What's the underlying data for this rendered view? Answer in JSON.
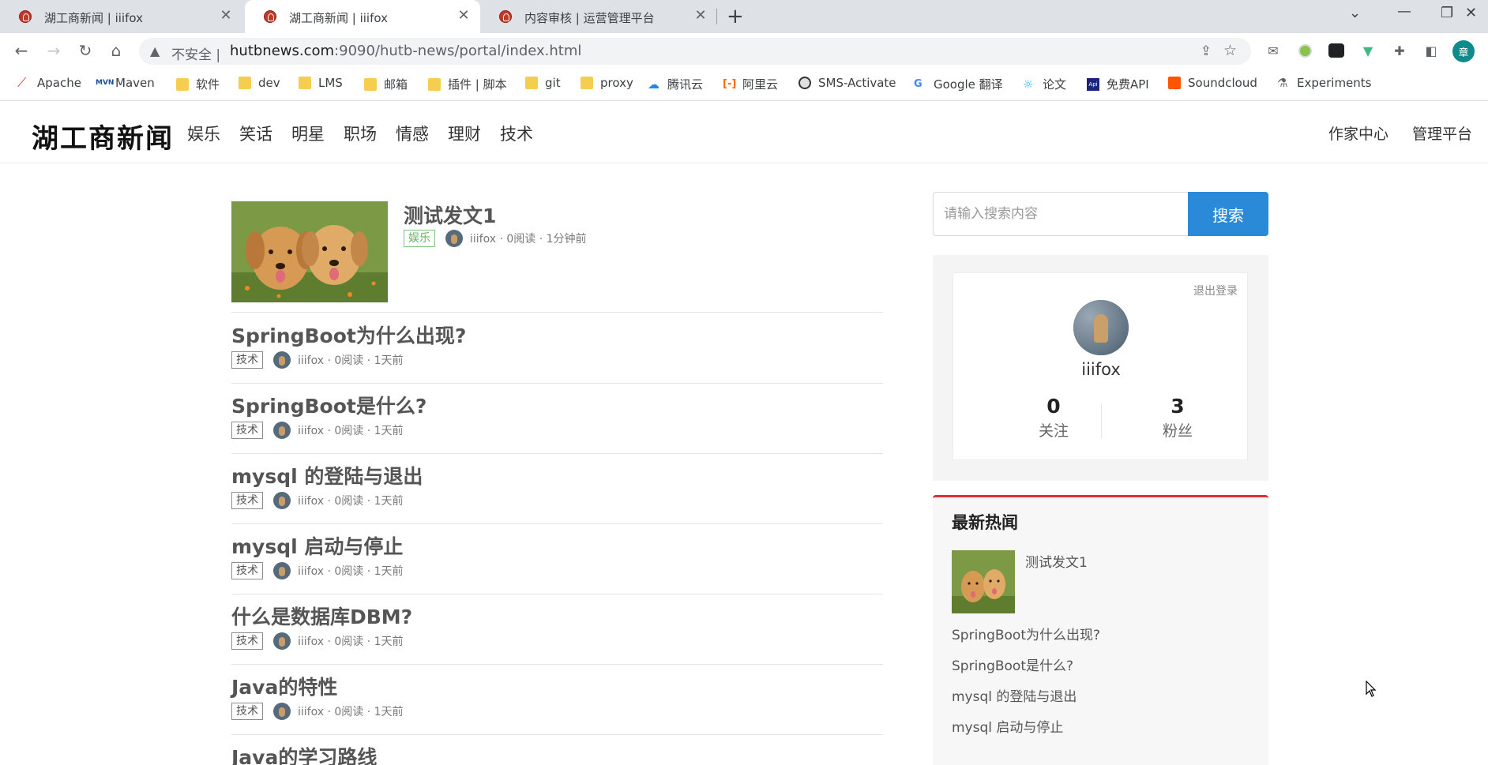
{
  "browser": {
    "tabs": [
      {
        "title": "湖工商新闻 | iiifox",
        "active": false
      },
      {
        "title": "湖工商新闻 | iiifox",
        "active": true
      },
      {
        "title": "内容审核 | 运营管理平台",
        "active": false
      }
    ],
    "new_tab_icon": "plus-icon",
    "security_label": "不安全",
    "url_host": "hutbnews.com",
    "url_rest": ":9090/hutb-news/portal/index.html",
    "profile_initial": "章",
    "bookmarks": [
      {
        "label": "Apache",
        "icon": "feather-icon"
      },
      {
        "label": "Maven",
        "icon": "maven-icon"
      },
      {
        "label": "软件",
        "icon": "folder-icon"
      },
      {
        "label": "dev",
        "icon": "folder-icon"
      },
      {
        "label": "LMS",
        "icon": "folder-icon"
      },
      {
        "label": "邮箱",
        "icon": "folder-icon"
      },
      {
        "label": "插件 | 脚本",
        "icon": "folder-icon"
      },
      {
        "label": "git",
        "icon": "folder-icon"
      },
      {
        "label": "proxy",
        "icon": "folder-icon"
      },
      {
        "label": "腾讯云",
        "icon": "cloud-icon"
      },
      {
        "label": "阿里云",
        "icon": "aliyun-icon"
      },
      {
        "label": "SMS-Activate",
        "icon": "sms-icon"
      },
      {
        "label": "Google 翻译",
        "icon": "translate-icon"
      },
      {
        "label": "论文",
        "icon": "paper-icon"
      },
      {
        "label": "免费API",
        "icon": "api-icon"
      },
      {
        "label": "Soundcloud",
        "icon": "soundcloud-icon"
      },
      {
        "label": "Experiments",
        "icon": "flask-icon"
      }
    ]
  },
  "site": {
    "logo": "湖工商新闻",
    "nav": [
      "娱乐",
      "笑话",
      "明星",
      "职场",
      "情感",
      "理财",
      "技术"
    ],
    "right_nav": [
      "作家中心",
      "管理平台"
    ]
  },
  "featured": {
    "title": "测试发文1",
    "tag": "娱乐",
    "meta": "iiifox · 0阅读 · 1分钟前"
  },
  "articles": [
    {
      "title": "SpringBoot为什么出现?",
      "tag": "技术",
      "meta": "iiifox · 0阅读 · 1天前"
    },
    {
      "title": "SpringBoot是什么?",
      "tag": "技术",
      "meta": "iiifox · 0阅读 · 1天前"
    },
    {
      "title": "mysql 的登陆与退出",
      "tag": "技术",
      "meta": "iiifox · 0阅读 · 1天前"
    },
    {
      "title": "mysql 启动与停止",
      "tag": "技术",
      "meta": "iiifox · 0阅读 · 1天前"
    },
    {
      "title": "什么是数据库DBM?",
      "tag": "技术",
      "meta": "iiifox · 0阅读 · 1天前"
    },
    {
      "title": "Java的特性",
      "tag": "技术",
      "meta": "iiifox · 0阅读 · 1天前"
    },
    {
      "title": "Java的学习路线",
      "tag": "",
      "meta": ""
    }
  ],
  "sidebar": {
    "search_placeholder": "请输入搜索内容",
    "search_button": "搜索",
    "logout": "退出登录",
    "username": "iiifox",
    "follow_count": "0",
    "follow_label": "关注",
    "fans_count": "3",
    "fans_label": "粉丝",
    "hot_title": "最新热闻",
    "hot_items": [
      "测试发文1",
      "SpringBoot为什么出现?",
      "SpringBoot是什么?",
      "mysql 的登陆与退出",
      "mysql 启动与停止"
    ]
  },
  "colors": {
    "search_button": "#2b8ad8",
    "hot_border": "#d63434",
    "tag_green": "#67b36a"
  }
}
